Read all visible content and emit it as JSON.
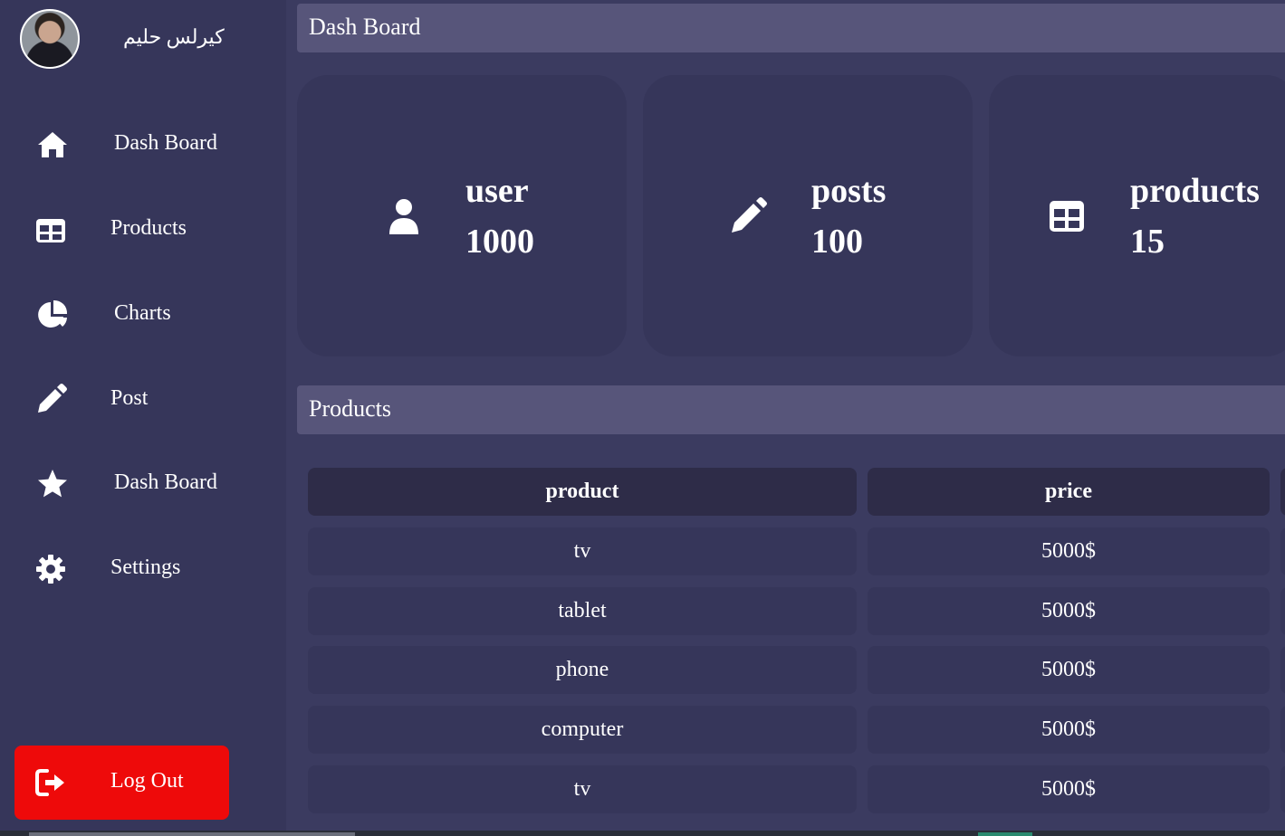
{
  "profile": {
    "name": "كيرلس حليم"
  },
  "sidebar": {
    "items": [
      {
        "label": "Dash Board",
        "icon": "home-icon"
      },
      {
        "label": "Products",
        "icon": "table-icon"
      },
      {
        "label": "Charts",
        "icon": "pie-chart-icon"
      },
      {
        "label": "Post",
        "icon": "pencil-icon"
      },
      {
        "label": "Dash Board",
        "icon": "star-icon"
      },
      {
        "label": "Settings",
        "icon": "gear-icon"
      }
    ],
    "logout": {
      "label": "Log Out",
      "icon": "logout-icon"
    }
  },
  "header": {
    "title": "Dash Board"
  },
  "stats": [
    {
      "label": "user",
      "value": "1000",
      "icon": "user-icon"
    },
    {
      "label": "posts",
      "value": "100",
      "icon": "pencil-icon"
    },
    {
      "label": "products",
      "value": "15",
      "icon": "table-icon"
    }
  ],
  "products_section": {
    "title": "Products",
    "columns": [
      "product",
      "price"
    ],
    "rows": [
      {
        "product": "tv",
        "price": "5000$"
      },
      {
        "product": "tablet",
        "price": "5000$"
      },
      {
        "product": "phone",
        "price": "5000$"
      },
      {
        "product": "computer",
        "price": "5000$"
      },
      {
        "product": "tv",
        "price": "5000$"
      }
    ]
  },
  "colors": {
    "background": "#3b3b60",
    "sidebar": "#36365a",
    "card": "#36365a",
    "header_bar": "#57557a",
    "table_head": "#2e2c48",
    "logout": "#ee0a0a",
    "text": "#ffffff"
  }
}
